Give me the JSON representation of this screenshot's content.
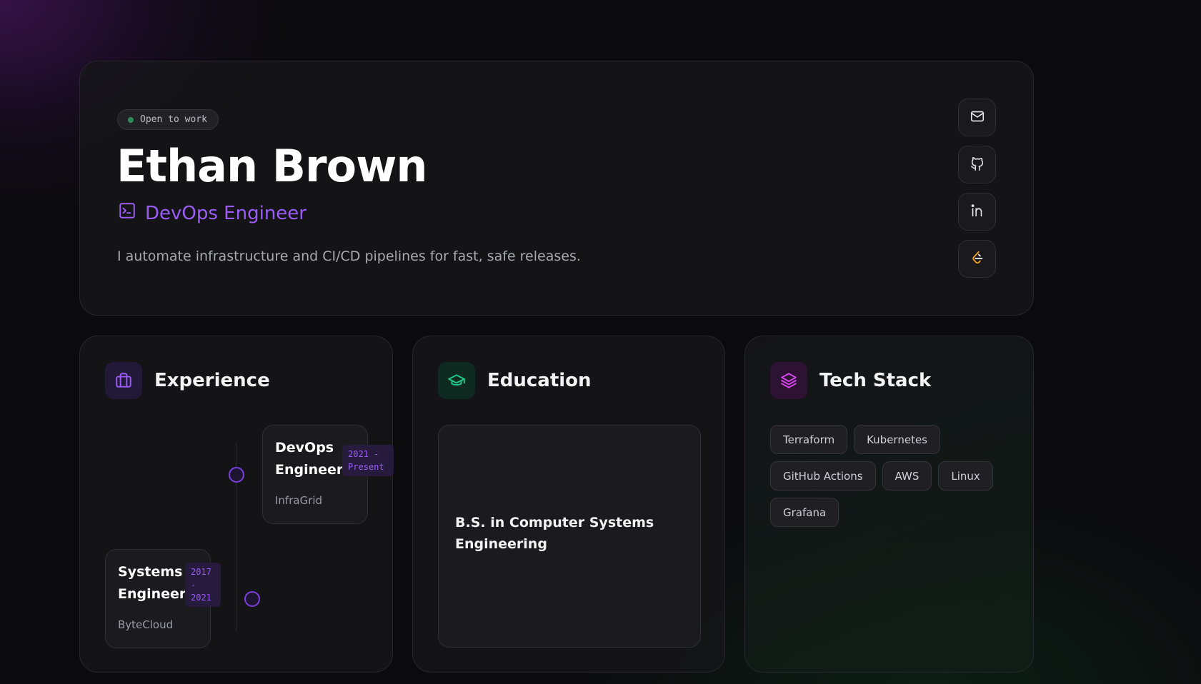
{
  "hero": {
    "status": "Open to work",
    "name": "Ethan Brown",
    "role": "DevOps Engineer",
    "description": "I automate infrastructure and CI/CD pipelines for fast, safe releases."
  },
  "social": [
    {
      "icon": "mail-icon"
    },
    {
      "icon": "github-icon"
    },
    {
      "icon": "linkedin-icon"
    },
    {
      "icon": "leetcode-icon"
    }
  ],
  "experience": {
    "title": "Experience",
    "jobs": [
      {
        "title": "DevOps Engineer",
        "company": "InfraGrid",
        "years": "2021 - Present"
      },
      {
        "title": "Systems Engineer",
        "company": "ByteCloud",
        "years": "2017 - 2021"
      }
    ]
  },
  "education": {
    "title": "Education",
    "degree": "B.S. in Computer Systems Engineering"
  },
  "tech": {
    "title": "Tech Stack",
    "items": [
      "Terraform",
      "Kubernetes",
      "GitHub Actions",
      "AWS",
      "Linux",
      "Grafana"
    ]
  },
  "colors": {
    "accent_purple": "#9b5cf6",
    "accent_green": "#22c58b",
    "accent_pink": "#d946ef",
    "status_dot": "#2e8a5e"
  }
}
